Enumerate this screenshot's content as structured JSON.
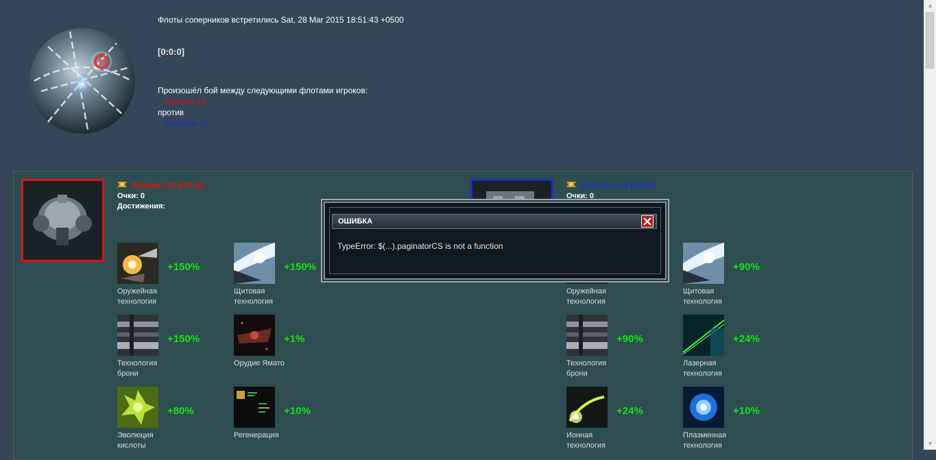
{
  "header": {
    "meet_text": "Флоты соперников встретились Sat, 28 Mar 2015 18:51:43 +0500",
    "coords": "[0:0:0]",
    "battle_between": "Произошёл бой между следующими флотами игроков:",
    "attacker_name": "Attacker #1",
    "versus": "против",
    "defender_name": "Defender #1"
  },
  "attacker": {
    "name": "Attacker #1",
    "coords": "[0:0:0]",
    "points": "Очки: 0",
    "achievements": "Достижения:",
    "techs": [
      {
        "label": "Оружейная технология",
        "value": "+150%",
        "icon": "weapon-tech-icon"
      },
      {
        "label": "Щитовая технология",
        "value": "+150%",
        "icon": "shield-tech-icon"
      },
      {
        "label": "Технология брони",
        "value": "+150%",
        "icon": "armor-tech-icon"
      },
      {
        "label": "Орудие Ямато",
        "value": "+1%",
        "icon": "yamato-cannon-icon"
      },
      {
        "label": "Эволюция кислоты",
        "value": "+80%",
        "icon": "acid-evolution-icon"
      },
      {
        "label": "Регенерация",
        "value": "+10%",
        "icon": "regeneration-icon"
      }
    ]
  },
  "defender": {
    "name": "Defender #1",
    "coords": "[0:0:0]",
    "points": "Очки: 0",
    "techs": [
      {
        "label": "Оружейная технология",
        "value": "",
        "icon": "weapon-tech-icon"
      },
      {
        "label": "Щитовая технология",
        "value": "+90%",
        "icon": "shield-tech-icon"
      },
      {
        "label": "Технология брони",
        "value": "+90%",
        "icon": "armor-tech-icon"
      },
      {
        "label": "Лазерная технология",
        "value": "+24%",
        "icon": "laser-tech-icon"
      },
      {
        "label": "Ионная технология",
        "value": "+24%",
        "icon": "ion-tech-icon"
      },
      {
        "label": "Плазменная технология",
        "value": "+10%",
        "icon": "plasma-tech-icon"
      }
    ]
  },
  "modal": {
    "title": "ОШИБКА",
    "message": "TypeError: $(...).paginatorCS is not a function"
  },
  "colors": {
    "page_bg": "#344658",
    "panel_bg": "#2e4d50",
    "attacker": "#e01212",
    "defender": "#1c2fc6",
    "bonus": "#19e319"
  }
}
